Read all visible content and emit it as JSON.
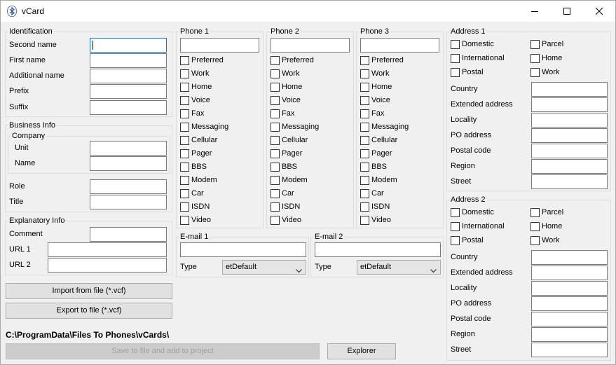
{
  "window": {
    "title": "vCard"
  },
  "identification": {
    "legend": "Identification",
    "second_name": "Second name",
    "first_name": "First name",
    "additional_name": "Additional name",
    "prefix": "Prefix",
    "suffix": "Suffix"
  },
  "business": {
    "legend": "Business Info",
    "company_legend": "Company",
    "unit": "Unit",
    "name": "Name",
    "role": "Role",
    "title": "Title"
  },
  "explanatory": {
    "legend": "Explanatory Info",
    "comment": "Comment",
    "url1": "URL 1",
    "url2": "URL 2"
  },
  "buttons": {
    "import": "Import from file (*.vcf)",
    "export": "Export to file (*.vcf)",
    "save": "Save to file and add to project",
    "explorer": "Explorer"
  },
  "path": "C:\\ProgramData\\Files To Phones\\vCards\\",
  "phones": [
    {
      "legend": "Phone 1"
    },
    {
      "legend": "Phone 2"
    },
    {
      "legend": "Phone 3"
    }
  ],
  "phone_types": [
    "Preferred",
    "Work",
    "Home",
    "Voice",
    "Fax",
    "Messaging",
    "Cellular",
    "Pager",
    "BBS",
    "Modem",
    "Car",
    "ISDN",
    "Video"
  ],
  "emails": [
    {
      "legend": "E-mail 1",
      "type_label": "Type",
      "type_value": "etDefault"
    },
    {
      "legend": "E-mail 2",
      "type_label": "Type",
      "type_value": "etDefault"
    }
  ],
  "addresses": [
    {
      "legend": "Address 1"
    },
    {
      "legend": "Address 2"
    }
  ],
  "address_types": {
    "left": [
      "Domestic",
      "International",
      "Postal"
    ],
    "right": [
      "Parcel",
      "Home",
      "Work"
    ]
  },
  "address_fields": [
    "Country",
    "Extended address",
    "Locality",
    "PO address",
    "Postal code",
    "Region",
    "Street"
  ]
}
